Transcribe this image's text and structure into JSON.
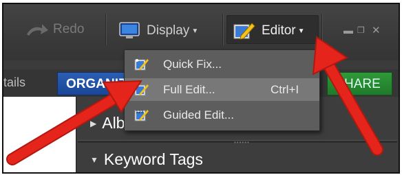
{
  "toolbar": {
    "redo_label": "Redo",
    "display_label": "Display",
    "editor_label": "Editor",
    "window_controls": [
      "–",
      "ᐥ",
      "×"
    ]
  },
  "tabs": {
    "details_partial": "tails",
    "organize_partial": "ORGANIZ",
    "share_partial": "HARE"
  },
  "editor_menu": {
    "items": [
      {
        "label": "Quick Fix...",
        "shortcut": "",
        "icon": "quick-fix-icon"
      },
      {
        "label": "Full Edit...",
        "shortcut": "Ctrl+I",
        "icon": "full-edit-icon"
      },
      {
        "label": "Guided Edit...",
        "shortcut": "",
        "icon": "guided-edit-icon"
      }
    ]
  },
  "panel": {
    "albums_partial": "Albu",
    "keyword_tags": "Keyword Tags"
  },
  "colors": {
    "organize_tab": "#1f4fa6",
    "share_tab": "#26893a",
    "annotation_arrow": "#e5251b"
  }
}
